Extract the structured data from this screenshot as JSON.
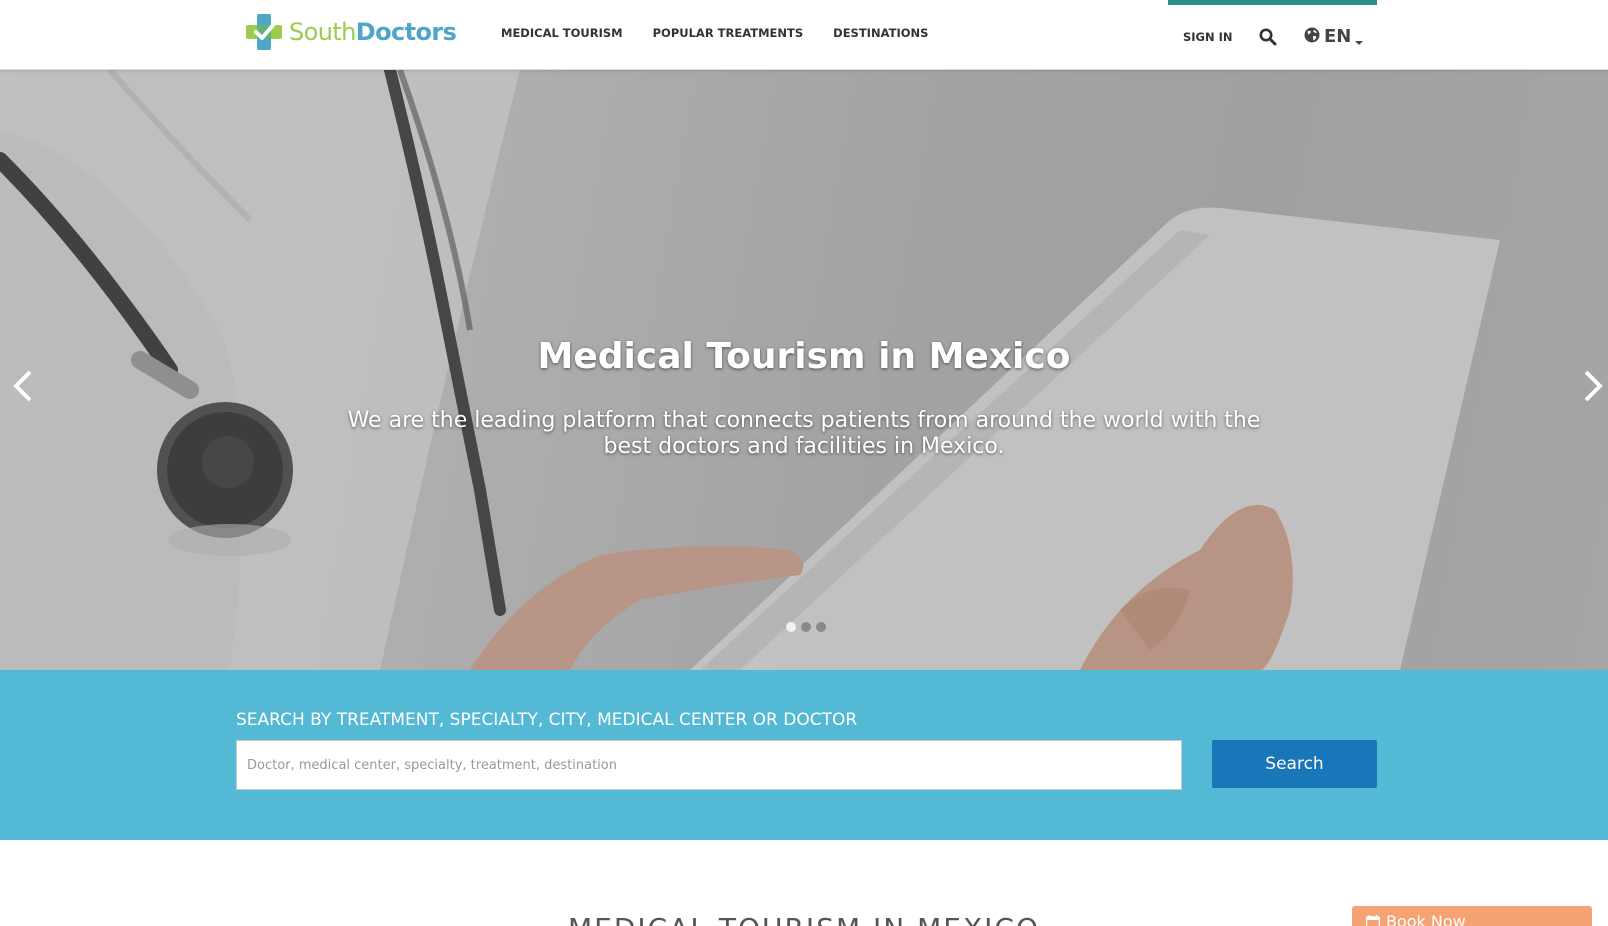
{
  "header": {
    "logo": {
      "part1": "South",
      "part2": "Doctors"
    },
    "nav": [
      {
        "label": "MEDICAL TOURISM"
      },
      {
        "label": "POPULAR TREATMENTS"
      },
      {
        "label": "DESTINATIONS"
      }
    ],
    "sign_in": "SIGN IN",
    "language": "EN"
  },
  "hero": {
    "title": "Medical Tourism in Mexico",
    "subtitle": "We are the leading platform that connects patients from around the world with the best doctors and facilities in Mexico.",
    "slide_count": 3,
    "active_slide": 1
  },
  "search": {
    "label": "SEARCH BY TREATMENT, SPECIALTY, CITY, MEDICAL CENTER OR DOCTOR",
    "placeholder": "Doctor, medical center, specialty, treatment, destination",
    "button": "Search"
  },
  "section": {
    "title": "MEDICAL TOURISM IN MEXICO"
  },
  "book_now": "Book Now",
  "colors": {
    "brand_green": "#9ccc4b",
    "brand_blue": "#4fa6c9",
    "accent_teal": "#2a8f86",
    "search_band": "#54b9d5",
    "search_button": "#1976b8",
    "book_now": "#f6a373"
  }
}
